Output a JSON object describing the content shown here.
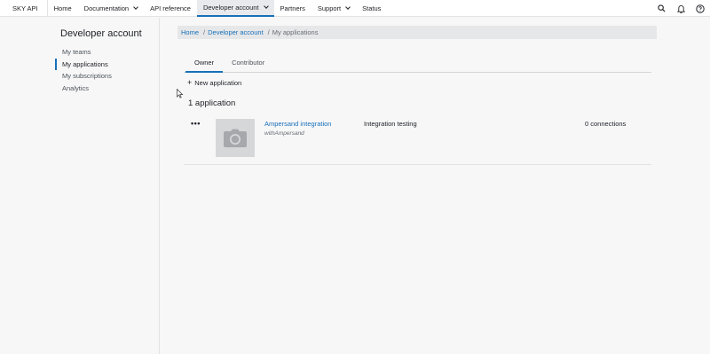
{
  "topnav": {
    "brand": "SKY API",
    "items": [
      {
        "label": "Home"
      },
      {
        "label": "Documentation"
      },
      {
        "label": "API reference"
      },
      {
        "label": "Developer account"
      },
      {
        "label": "Partners"
      },
      {
        "label": "Support"
      },
      {
        "label": "Status"
      }
    ],
    "active": "Developer account",
    "icons": [
      "search-icon",
      "bell-icon",
      "help-icon"
    ]
  },
  "sidebar": {
    "title": "Developer account",
    "items": [
      {
        "label": "My teams"
      },
      {
        "label": "My applications"
      },
      {
        "label": "My subscriptions"
      },
      {
        "label": "Analytics"
      }
    ],
    "active": "My applications"
  },
  "breadcrumb": {
    "home": "Home",
    "section": "Developer account",
    "sep": "/",
    "current": "My applications"
  },
  "tabs": [
    {
      "label": "Owner"
    },
    {
      "label": "Contributor"
    }
  ],
  "actions": {
    "new_application": "New application"
  },
  "apps": {
    "heading": "1 application",
    "list": [
      {
        "name": "Ampersand integration",
        "owner": "withAmpersand",
        "environment": "Integration testing",
        "connections": "0 connections"
      }
    ]
  },
  "colors": {
    "accent": "#1870b8",
    "background": "#f7f7f8",
    "text": "#212327"
  }
}
